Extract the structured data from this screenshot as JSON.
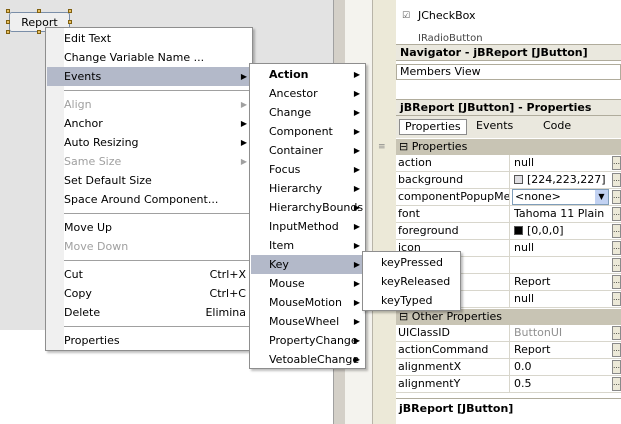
{
  "designer": {
    "component_label": "Report"
  },
  "palette": {
    "item_label": "JCheckBox",
    "clipped_item": "JRadioButton"
  },
  "navigator": {
    "title": "Navigator - jBReport [JButton]",
    "view_label": "Members View"
  },
  "properties_panel": {
    "title": "jBReport [JButton] - Properties",
    "tabs": [
      "Properties",
      "Events",
      "Code"
    ],
    "active_tab": "Properties",
    "section_main": "Properties",
    "section_other": "Other Properties",
    "rows": [
      {
        "name": "action",
        "value": "null"
      },
      {
        "name": "background",
        "value": "[224,223,227]",
        "swatch": "#e0dfe3"
      },
      {
        "name": "componentPopupMenu",
        "value": "<none>"
      },
      {
        "name": "font",
        "value": "Tahoma 11 Plain"
      },
      {
        "name": "foreground",
        "value": "[0,0,0]",
        "swatch": "#000000"
      },
      {
        "name": "icon",
        "value": "null"
      },
      {
        "name": "",
        "value": ""
      },
      {
        "name": "",
        "value": "Report"
      },
      {
        "name": "",
        "value": "null"
      }
    ],
    "other_rows": [
      {
        "name": "UIClassID",
        "value": "ButtonUI",
        "dim": true
      },
      {
        "name": "actionCommand",
        "value": "Report"
      },
      {
        "name": "alignmentX",
        "value": "0.0"
      },
      {
        "name": "alignmentY",
        "value": "0.5"
      }
    ],
    "description_title": "jBReport [JButton]"
  },
  "context_menu": {
    "items": [
      {
        "label": "Edit Text"
      },
      {
        "label": "Change Variable Name ..."
      },
      {
        "label": "Events",
        "submenu": true,
        "highlighted": true
      },
      {
        "label": "Align",
        "submenu": true,
        "disabled": true
      },
      {
        "label": "Anchor",
        "submenu": true
      },
      {
        "label": "Auto Resizing",
        "submenu": true
      },
      {
        "label": "Same Size",
        "submenu": true,
        "disabled": true
      },
      {
        "label": "Set Default Size"
      },
      {
        "label": "Space Around Component..."
      },
      {
        "label": "Move Up"
      },
      {
        "label": "Move Down",
        "disabled": true
      },
      {
        "label": "Cut",
        "accelerator": "Ctrl+X"
      },
      {
        "label": "Copy",
        "accelerator": "Ctrl+C"
      },
      {
        "label": "Delete",
        "accelerator": "Elimina"
      },
      {
        "label": "Properties"
      }
    ]
  },
  "events_menu": {
    "items": [
      {
        "label": "Action",
        "bold": true
      },
      {
        "label": "Ancestor"
      },
      {
        "label": "Change"
      },
      {
        "label": "Component"
      },
      {
        "label": "Container"
      },
      {
        "label": "Focus"
      },
      {
        "label": "Hierarchy"
      },
      {
        "label": "HierarchyBounds"
      },
      {
        "label": "InputMethod"
      },
      {
        "label": "Item"
      },
      {
        "label": "Key",
        "highlighted": true
      },
      {
        "label": "Mouse"
      },
      {
        "label": "MouseMotion"
      },
      {
        "label": "MouseWheel"
      },
      {
        "label": "PropertyChange"
      },
      {
        "label": "VetoableChange"
      }
    ]
  },
  "key_menu": {
    "items": [
      {
        "label": "keyPressed"
      },
      {
        "label": "keyReleased"
      },
      {
        "label": "keyTyped"
      }
    ]
  },
  "colors": {
    "menu_highlight": "#b3b9c9",
    "canvas": "#e3e3e3",
    "pane_header": "#eae8de"
  }
}
